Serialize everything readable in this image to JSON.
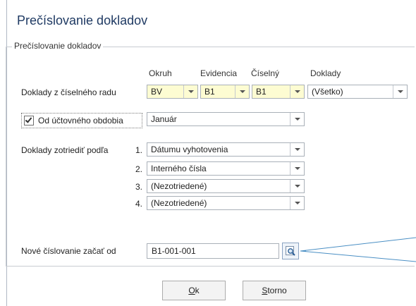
{
  "dialog": {
    "title": "Prečíslovanie dokladov"
  },
  "group": {
    "legend": "Prečíslovanie dokladov"
  },
  "columns": {
    "okruh": "Okruh",
    "evidencia": "Evidencia",
    "ciselny": "Číselný",
    "doklady": "Doklady"
  },
  "row_series": {
    "label": "Doklady z číselného radu",
    "okruh_value": "BV",
    "evidencia_value": "B1",
    "ciselny_value": "B1",
    "doklady_value": "(Všetko)"
  },
  "row_period": {
    "checkbox_label": "Od účtovného obdobia",
    "checked": true,
    "value": "Január"
  },
  "sort": {
    "label": "Doklady zotriediť podľa",
    "items": [
      {
        "index": "1.",
        "value": "Dátumu vyhotovenia"
      },
      {
        "index": "2.",
        "value": "Interného čísla"
      },
      {
        "index": "3.",
        "value": "(Nezotriedené)"
      },
      {
        "index": "4.",
        "value": "(Nezotriedené)"
      }
    ]
  },
  "numbering": {
    "label": "Nové číslovanie začať od",
    "value": "B1-001-001",
    "lookup_icon": "magnifier-icon"
  },
  "buttons": {
    "ok_mnemonic": "O",
    "ok_rest": "k",
    "storno_mnemonic": "S",
    "storno_rest": "torno"
  },
  "colors": {
    "title": "#1f3a63",
    "highlight_field": "#fdfcd2",
    "callout": "#4a8fc4"
  }
}
